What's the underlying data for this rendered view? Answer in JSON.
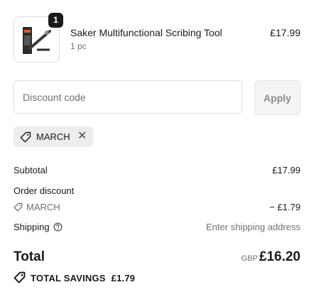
{
  "product": {
    "name": "Saker Multifunctional Scribing Tool",
    "variant": "1 pc",
    "price": "£17.99",
    "quantity": "1",
    "image_icon": "scribing-tool-image"
  },
  "discount_form": {
    "placeholder": "Discount code",
    "apply_label": "Apply"
  },
  "applied_discount": {
    "code": "MARCH",
    "tag_icon": "tag-icon",
    "remove_icon": "close-icon"
  },
  "summary": {
    "subtotal_label": "Subtotal",
    "subtotal_value": "£17.99",
    "order_discount_label": "Order discount",
    "discount_code": "MARCH",
    "discount_value": "− £1.79",
    "shipping_label": "Shipping",
    "shipping_value": "Enter shipping address",
    "total_label": "Total",
    "currency": "GBP",
    "total_value": "£16.20",
    "savings_label": "TOTAL SAVINGS",
    "savings_value": "£1.79"
  },
  "colors": {
    "text": "#1a1a1a",
    "muted": "#707070",
    "chip_background": "#ededed",
    "button_background": "#f4f4f4"
  }
}
